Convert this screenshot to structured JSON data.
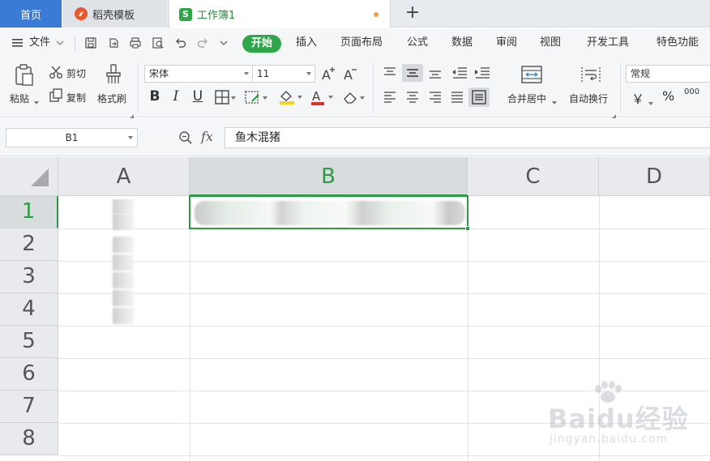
{
  "tabs": {
    "home": "首页",
    "daoke": "稻壳模板",
    "workbook": "工作簿1",
    "workbook_icon": "S",
    "new_tab": "+"
  },
  "menubar": {
    "file": "文件",
    "start": "开始",
    "items": [
      "插入",
      "页面布局",
      "公式",
      "数据",
      "审阅",
      "视图",
      "开发工具",
      "特色功能"
    ]
  },
  "ribbon": {
    "paste": "粘贴",
    "cut": "剪切",
    "copy": "复制",
    "format_painter": "格式刷",
    "font_name": "宋体",
    "font_size": "11",
    "bold": "B",
    "italic": "I",
    "underline": "U",
    "merge_center": "合并居中",
    "wrap_text": "自动换行",
    "number_format": "常规",
    "currency": "￥",
    "percent": "%",
    "thousands": "000"
  },
  "formula_bar": {
    "cell_ref": "B1",
    "fx": "fx",
    "content": "鱼木混猪"
  },
  "grid": {
    "columns": [
      "A",
      "B",
      "C",
      "D"
    ],
    "rows": [
      "1",
      "2",
      "3",
      "4",
      "5",
      "6",
      "7",
      "8"
    ],
    "selected_cell": "B1"
  },
  "watermark": {
    "text": "Baidu经验",
    "sub": "jingyan.baidu.com"
  },
  "colors": {
    "accent_green": "#2fa64a",
    "home_tab_blue": "#3a7bd5",
    "selection_green": "#2f9a45"
  }
}
